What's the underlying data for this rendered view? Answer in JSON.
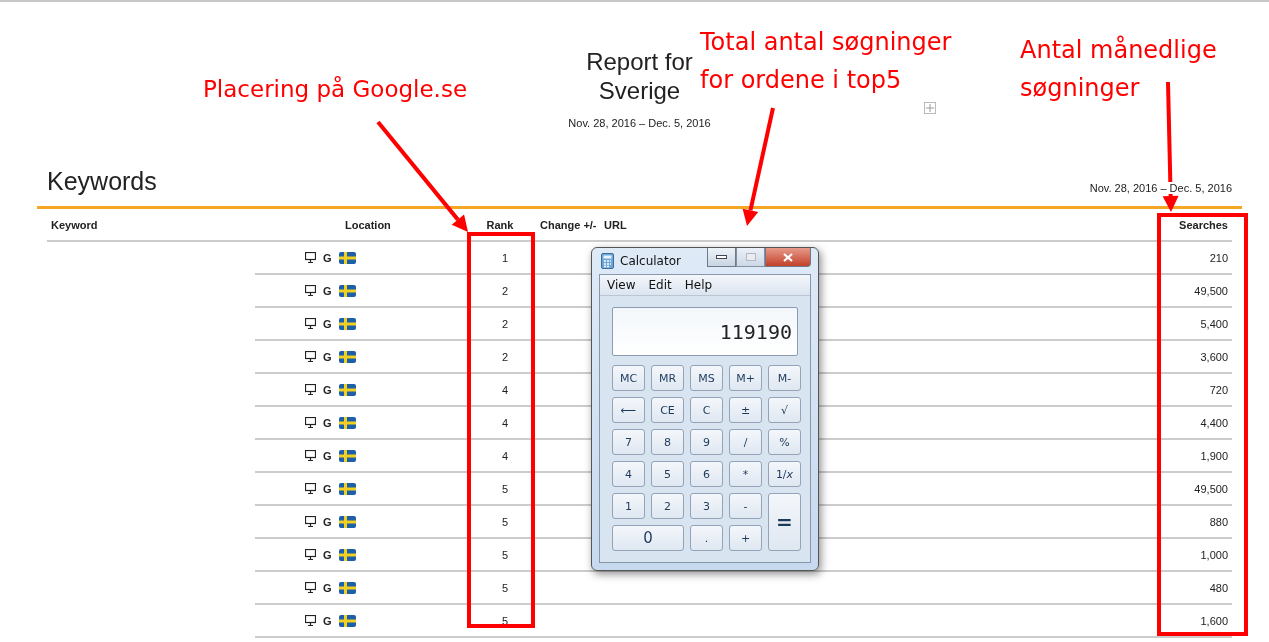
{
  "report": {
    "title": "Report for Sverige",
    "date_range": "Nov. 28, 2016 – Dec. 5, 2016"
  },
  "keywords": {
    "title": "Keywords",
    "date_range": "Nov. 28, 2016 – Dec. 5, 2016",
    "columns": [
      "Keyword",
      "Location",
      "Rank",
      "Change +/-",
      "URL",
      "Searches"
    ],
    "rows": [
      {
        "engine": "G",
        "rank": "1",
        "searches": "210"
      },
      {
        "engine": "G",
        "rank": "2",
        "searches": "49,500"
      },
      {
        "engine": "G",
        "rank": "2",
        "searches": "5,400"
      },
      {
        "engine": "G",
        "rank": "2",
        "searches": "3,600"
      },
      {
        "engine": "G",
        "rank": "4",
        "searches": "720"
      },
      {
        "engine": "G",
        "rank": "4",
        "searches": "4,400"
      },
      {
        "engine": "G",
        "rank": "4",
        "searches": "1,900"
      },
      {
        "engine": "G",
        "rank": "5",
        "searches": "49,500"
      },
      {
        "engine": "G",
        "rank": "5",
        "searches": "880"
      },
      {
        "engine": "G",
        "rank": "5",
        "searches": "1,000"
      },
      {
        "engine": "G",
        "rank": "5",
        "searches": "480"
      },
      {
        "engine": "G",
        "rank": "5",
        "searches": "1,600"
      }
    ]
  },
  "calculator": {
    "title": "Calculator",
    "menu": [
      "View",
      "Edit",
      "Help"
    ],
    "display": "119190",
    "buttons": [
      {
        "label": "MC",
        "kind": "normal"
      },
      {
        "label": "MR",
        "kind": "normal"
      },
      {
        "label": "MS",
        "kind": "normal"
      },
      {
        "label": "M+",
        "kind": "normal"
      },
      {
        "label": "M-",
        "kind": "normal"
      },
      {
        "label": "⟵",
        "kind": "normal"
      },
      {
        "label": "CE",
        "kind": "normal"
      },
      {
        "label": "C",
        "kind": "normal"
      },
      {
        "label": "±",
        "kind": "normal"
      },
      {
        "label": "√",
        "kind": "normal"
      },
      {
        "label": "7",
        "kind": "normal"
      },
      {
        "label": "8",
        "kind": "normal"
      },
      {
        "label": "9",
        "kind": "normal"
      },
      {
        "label": "/",
        "kind": "normal"
      },
      {
        "label": "%",
        "kind": "normal"
      },
      {
        "label": "4",
        "kind": "normal"
      },
      {
        "label": "5",
        "kind": "normal"
      },
      {
        "label": "6",
        "kind": "normal"
      },
      {
        "label": "*",
        "kind": "normal"
      },
      {
        "label": "1/*x*",
        "kind": "normal"
      },
      {
        "label": "1",
        "kind": "normal"
      },
      {
        "label": "2",
        "kind": "normal"
      },
      {
        "label": "3",
        "kind": "normal"
      },
      {
        "label": "-",
        "kind": "normal"
      },
      {
        "label": "=",
        "kind": "tall"
      },
      {
        "label": "0",
        "kind": "wide"
      },
      {
        "label": ".",
        "kind": "normal"
      },
      {
        "label": "+",
        "kind": "normal"
      }
    ]
  },
  "annotations": [
    {
      "text": "Placering på Google.se",
      "kind": "rank"
    },
    {
      "text": "Total antal søgninger for ordene i top5",
      "kind": "total"
    },
    {
      "text": "Antal månedlige søgninger",
      "kind": "searches"
    }
  ]
}
